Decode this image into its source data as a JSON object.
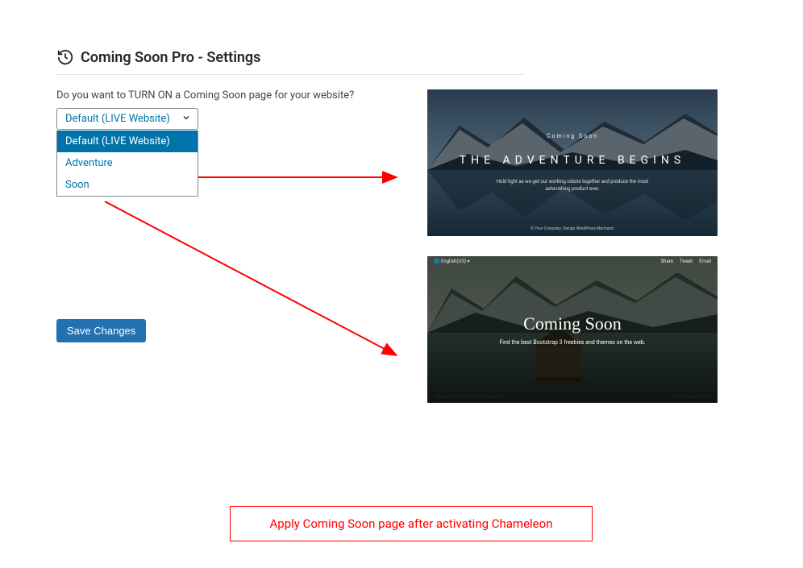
{
  "header": {
    "title": "Coming Soon Pro - Settings"
  },
  "settings": {
    "question": "Do you want to TURN ON a Coming Soon page for your website?",
    "selected": "Default (LIVE Website)",
    "options": [
      "Default (LIVE Website)",
      "Adventure",
      "Soon"
    ],
    "save_label": "Save Changes"
  },
  "previews": {
    "adventure": {
      "top": "Coming Soon",
      "title": "THE ADVENTURE BEGINS",
      "sub": "Hold tight as we get our working robots together and produce the most astonishing product ever.",
      "footer": "© Your Company. Design WordPress Mechanic"
    },
    "soon": {
      "lang": "🌐 English(US) ▾",
      "social_share": "Share",
      "social_tweet": "Tweet",
      "social_email": "Email",
      "title": "Coming Soon",
      "sub": "Find the best Bootstrap 3 freebies and themes on the web.",
      "footer_left": "Made with ♥ by WordPress Mechanic",
      "footer_right": "Free download here"
    }
  },
  "caption": "Apply Coming Soon page after activating Chameleon"
}
